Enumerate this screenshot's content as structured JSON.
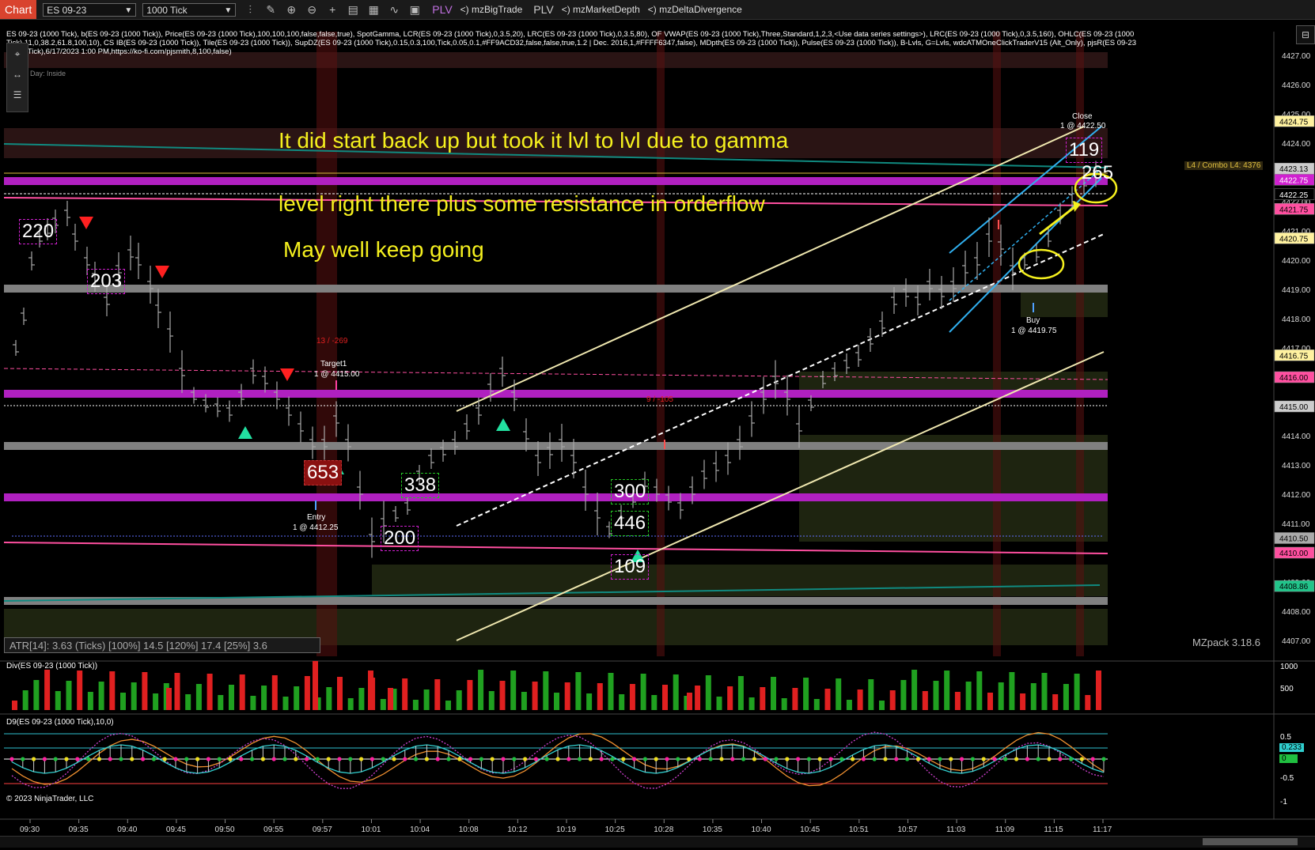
{
  "toolbar": {
    "tab": "Chart",
    "instrument": "ES 09-23",
    "period": "1000 Tick",
    "plv1": "PLV",
    "item1": "mzBigTrade",
    "plv2": "PLV",
    "item2": "mzMarketDepth",
    "item3": "mzDeltaDivergence",
    "icons": [
      "bars-icon",
      "pencil-icon",
      "zoom-in-icon",
      "zoom-out-icon",
      "crosshair-icon",
      "properties-icon",
      "indicators-icon",
      "strategies-icon",
      "templates-icon"
    ]
  },
  "header": {
    "line1": "ES 09-23 (1000 Tick), b(ES 09-23 (1000 Tick)), Price(ES 09-23 (1000 Tick),100,100,100,false,false,true), SpotGamma, LCR(ES 09-23 (1000 Tick),0,3.5,20), LRC(ES 09-23 (1000 Tick),0,3.5,80), OF VWAP(ES 09-23 (1000 Tick),Three,Standard,1,2,3,<Use data series settings>), LRC(ES 09-23 (1000 Tick),0,3.5,160), OHLC(ES 09-23 (1000",
    "line2": "Tick),11,0,38.2,61.8,100,10), CS IB(ES 09-23 (1000 Tick)), Tile(ES 09-23 (1000 Tick)), SupDZ(ES 09-23 (1000 Tick),0.15,0.3,100,Tick,0.05,0.1,#FF9ACD32,false,false,true,1.2 | Dec. 2016,1,#FFFF6347,false), MDpth(ES 09-23 (1000 Tick)), Pulse(ES 09-23 (1000 Tick)), B-Lvls, G=Lvls, wdcATMOneClickTraderV15 (Alt_Only), pjsR(ES 09-23",
    "line3": "(1000 Tick),6/17/2023 1:00 PM,https://ko-fi.com/pjsmith,8,100,false)",
    "day": "Day: Inside"
  },
  "annotations": {
    "a1": "It did start back up but took it lvl to lvl due to gamma",
    "a2": "level right there plus some resistance in orderflow",
    "a3": "May well keep going"
  },
  "boxes": {
    "b220": "220",
    "b203": "203",
    "b653": "653",
    "b338": "338",
    "b200": "200",
    "b300": "300",
    "b446": "446",
    "b109": "109",
    "b119": "119",
    "b265": "265"
  },
  "labels": {
    "target": "Target1",
    "target_detail": "1 @ 4415.00",
    "entry": "Entry",
    "entry_detail": "1 @ 4412.25",
    "buy": "Buy",
    "buy_detail": "1 @ 4419.75",
    "close": "Close",
    "close_detail": "1 @ 4422.50",
    "red1": "13 / -269",
    "red2": "9 / -105",
    "l4": "L4 / Combo L4: 4376"
  },
  "price_axis": {
    "ticks": [
      "4427.00",
      "4426.00",
      "4425.00",
      "4424.00",
      "4423.00",
      "4422.00",
      "4421.00",
      "4420.00",
      "4419.00",
      "4418.00",
      "4417.00",
      "4416.00",
      "4415.00",
      "4414.00",
      "4413.00",
      "4412.00",
      "4411.00",
      "4410.00",
      "4409.00",
      "4408.00",
      "4407.00"
    ],
    "tags": [
      {
        "text": "4424.75",
        "bg": "#fff2a0",
        "fg": "#000"
      },
      {
        "text": "4423.13",
        "bg": "#cccccc",
        "fg": "#000"
      },
      {
        "text": "4422.75",
        "bg": "#d020d0",
        "fg": "#fff"
      },
      {
        "text": "4422.25",
        "bg": "#000000",
        "fg": "#fff"
      },
      {
        "text": "4421.75",
        "bg": "#ff4fa0",
        "fg": "#000"
      },
      {
        "text": "4420.75",
        "bg": "#fff2a0",
        "fg": "#000"
      },
      {
        "text": "4416.75",
        "bg": "#fff2a0",
        "fg": "#000"
      },
      {
        "text": "4416.00",
        "bg": "#ff4fa0",
        "fg": "#000"
      },
      {
        "text": "4415.00",
        "bg": "#cccccc",
        "fg": "#000"
      },
      {
        "text": "4410.50",
        "bg": "#aaaaaa",
        "fg": "#000"
      },
      {
        "text": "4410.00",
        "bg": "#ff4fa0",
        "fg": "#000"
      },
      {
        "text": "4408.86",
        "bg": "#22c48a",
        "fg": "#000"
      }
    ]
  },
  "time_axis": [
    "09:30",
    "09:35",
    "09:40",
    "09:45",
    "09:50",
    "09:55",
    "09:57",
    "10:01",
    "10:04",
    "10:08",
    "10:12",
    "10:19",
    "10:25",
    "10:28",
    "10:35",
    "10:40",
    "10:45",
    "10:51",
    "10:57",
    "11:03",
    "11:09",
    "11:15",
    "11:17"
  ],
  "atr": "ATR[14]: 3.63 (Ticks) [100%] 14.5  [120%] 17.4  [25%] 3.6",
  "mzpack": "MZpack 3.18.6",
  "div_panel": {
    "label": "Div(ES 09-23 (1000 Tick))",
    "ticks": [
      "1000",
      "500"
    ]
  },
  "d9_panel": {
    "label": "D9(ES 09-23 (1000 Tick),10,0)",
    "ticks": [
      "0.5",
      "0.233",
      "0",
      "-0.5",
      "-1"
    ]
  },
  "copyright": "© 2023 NinjaTrader, LLC",
  "colors": {
    "magenta_level": "#b020c0",
    "grey_level": "#808080",
    "annotation": "#f5f01e",
    "candle": "#aaaaaa",
    "up_arrow": "#22e0a0",
    "down_arrow": "#ff2020"
  }
}
